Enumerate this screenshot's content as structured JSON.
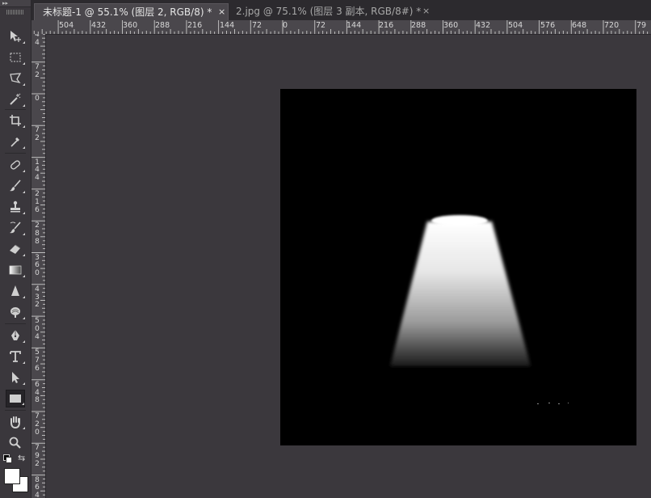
{
  "toolbar": {
    "collapse_label": "▸▸",
    "tools": [
      "move-icon",
      "rect-marquee-icon",
      "polygonal-lasso-icon",
      "magic-wand-icon",
      "crop-icon",
      "eyedropper-icon",
      "healing-brush-icon",
      "brush-icon",
      "clone-stamp-icon",
      "history-brush-icon",
      "eraser-icon",
      "gradient-icon",
      "blur-icon",
      "dodge-icon",
      "pen-icon",
      "type-icon",
      "path-selection-icon",
      "rectangle-shape-icon",
      "hand-icon",
      "zoom-icon"
    ],
    "active_tool": "rectangle-shape-icon",
    "foreground_color": "#ffffff",
    "background_color": "#ffffff"
  },
  "tabs": [
    {
      "label": "未标题-1 @ 55.1% (图层 2, RGB/8) *",
      "close": "×",
      "active": true
    },
    {
      "label": "2.jpg @ 75.1% (图层 3 副本, RGB/8#) *",
      "close": "×",
      "active": false
    }
  ],
  "rulers": {
    "horizontal": [
      "504",
      "432",
      "360",
      "288",
      "216",
      "144",
      "72",
      "0",
      "72",
      "144",
      "216",
      "288",
      "360",
      "432",
      "504",
      "576",
      "648",
      "720",
      "79"
    ],
    "vertical": [
      [
        "4",
        "4"
      ],
      [
        "7",
        "2"
      ],
      [
        "0"
      ],
      [
        "7",
        "2"
      ],
      [
        "1",
        "4",
        "4"
      ],
      [
        "2",
        "1",
        "6"
      ],
      [
        "2",
        "8",
        "8"
      ],
      [
        "3",
        "6",
        "0"
      ],
      [
        "4",
        "3",
        "2"
      ],
      [
        "5",
        "0",
        "4"
      ],
      [
        "5",
        "7",
        "6"
      ],
      [
        "6",
        "4",
        "8"
      ],
      [
        "7",
        "2",
        "0"
      ],
      [
        "7",
        "9",
        "2"
      ],
      [
        "8",
        "6",
        "4"
      ]
    ]
  },
  "canvas": {
    "background": "#000000",
    "accent": "#ffffff"
  }
}
